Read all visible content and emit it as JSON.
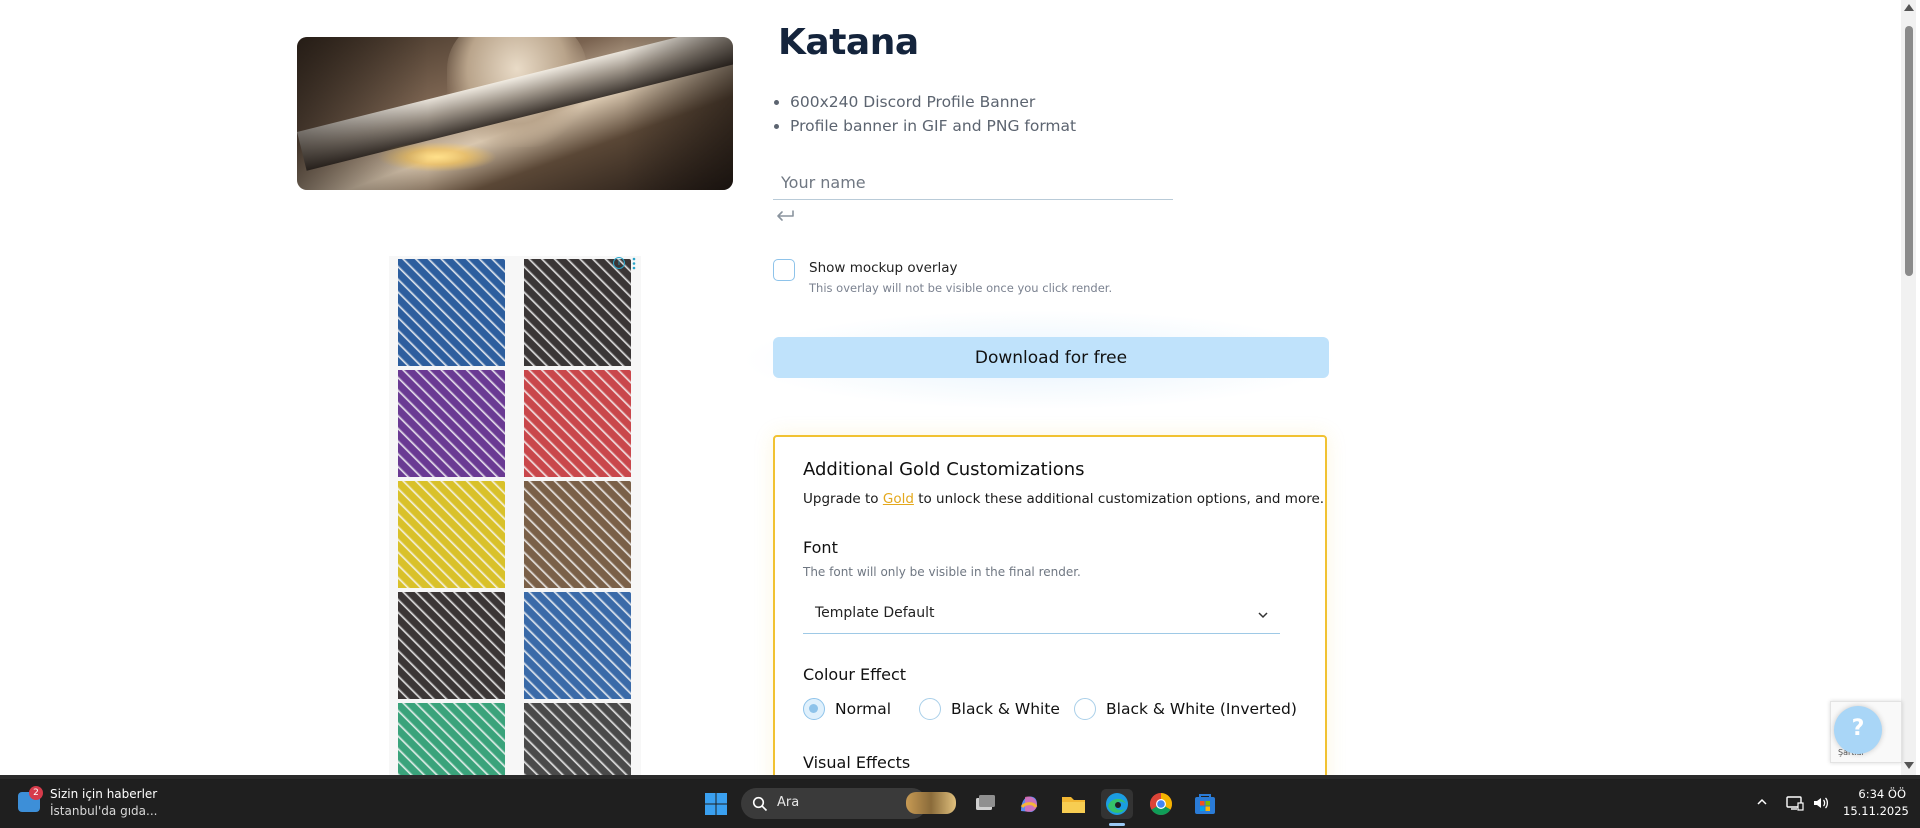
{
  "product": {
    "title": "Katana",
    "features": [
      "600x240 Discord Profile Banner",
      "Profile banner in GIF and PNG format"
    ],
    "name_placeholder": "Your name"
  },
  "mockup": {
    "label": "Show mockup overlay",
    "hint": "This overlay will not be visible once you click render.",
    "checked": false
  },
  "download": {
    "label": "Download for free"
  },
  "gold": {
    "title": "Additional Gold Customizations",
    "desc_before": "Upgrade to ",
    "desc_link": "Gold",
    "desc_after": " to unlock these additional customization options, and more.",
    "font_label": "Font",
    "font_hint": "The font will only be visible in the final render.",
    "font_value": "Template Default",
    "colour_label": "Colour Effect",
    "colour_options": [
      "Normal",
      "Black & White",
      "Black & White (Inverted)"
    ],
    "colour_selected": "Normal",
    "visual_label": "Visual Effects"
  },
  "ad": {
    "tile_colors": [
      "#2d5e9e",
      "#3a3636",
      "#6a3a93",
      "#c9474b",
      "#d9c12a",
      "#7a6048",
      "#3b3636",
      "#3a6aa8",
      "#3aa37b",
      "#4a4a4a"
    ]
  },
  "recaptcha": {
    "text": "Şartlar"
  },
  "taskbar": {
    "news_title": "Sizin için haberler",
    "news_subtitle": "İstanbul'da gıda...",
    "news_badge": "2",
    "search_text": "Ara",
    "time": "6:34 ÖÖ",
    "date": "15.11.2025"
  }
}
